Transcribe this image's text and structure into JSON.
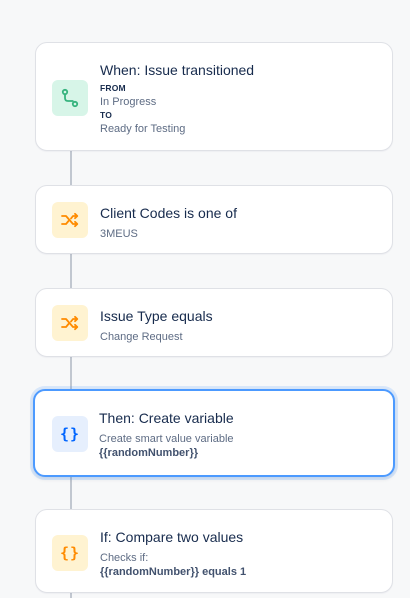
{
  "flow": {
    "trigger": {
      "title": "When: Issue transitioned",
      "from_label": "FROM",
      "from_value": "In Progress",
      "to_label": "TO",
      "to_value": "Ready for Testing",
      "icon": "branch-flow-icon",
      "icon_color": "#36b37e"
    },
    "condition1": {
      "title": "Client Codes is one of",
      "value": "3MEUS",
      "icon": "shuffle-icon",
      "icon_color": "#ff8b00"
    },
    "condition2": {
      "title": "Issue Type equals",
      "value": "Change Request",
      "icon": "shuffle-icon",
      "icon_color": "#ff8b00"
    },
    "action": {
      "title": "Then: Create variable",
      "description": "Create smart value variable",
      "variable": "{{randomNumber}}",
      "icon": "curly-braces-icon",
      "icon_color": "#0065ff",
      "selected_border": "#4c9aff"
    },
    "compare": {
      "title": "If: Compare two values",
      "checks_label": "Checks if:",
      "variable": "{{randomNumber}}",
      "condition": "equals 1",
      "icon": "curly-braces-icon",
      "icon_color": "#ff8b00"
    }
  }
}
